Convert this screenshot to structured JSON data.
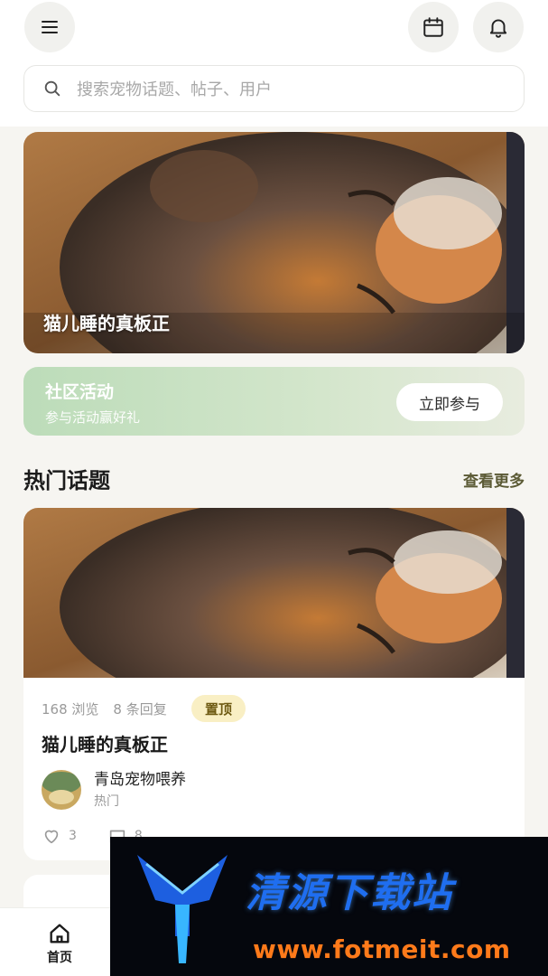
{
  "search": {
    "placeholder": "搜索宠物话题、帖子、用户"
  },
  "banner": {
    "title": "猫儿睡的真板正"
  },
  "activity": {
    "title": "社区活动",
    "subtitle": "参与活动赢好礼",
    "button": "立即参与"
  },
  "hot": {
    "title": "热门话题",
    "more": "查看更多",
    "post": {
      "views": "168 浏览",
      "replies": "8 条回复",
      "badge": "置顶",
      "title": "猫儿睡的真板正",
      "author": "青岛宠物喂养",
      "tag": "热门",
      "likes": "3",
      "comments": "8"
    }
  },
  "tabbar": {
    "home": "首页"
  },
  "watermark": {
    "title": "清源下载站",
    "url": "www.fotmeit.com"
  },
  "icons": [
    "menu-icon",
    "calendar-icon",
    "bell-icon",
    "search-icon",
    "heart-icon",
    "comment-icon",
    "home-icon"
  ],
  "colors": {
    "accent": "#bcdcb9",
    "badge_bg": "#f9efc4",
    "more_link": "#5b5a35"
  }
}
